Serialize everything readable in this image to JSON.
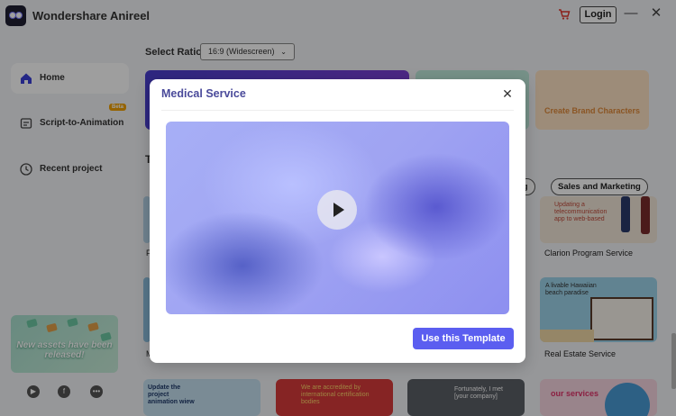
{
  "app": {
    "title": "Wondershare Anireel"
  },
  "header": {
    "login_label": "Login",
    "minimize_symbol": "—",
    "close_symbol": "✕"
  },
  "sidebar": {
    "items": [
      {
        "label": "Home",
        "icon": "home-icon",
        "active": true
      },
      {
        "label": "Script-to-Animation",
        "icon": "script-icon",
        "badge": "Beta"
      },
      {
        "label": "Recent project",
        "icon": "clock-icon"
      }
    ],
    "promo": {
      "text": "New assets have been released!"
    },
    "social": [
      "youtube-icon",
      "facebook-icon",
      "discord-icon"
    ]
  },
  "main": {
    "ratio_label": "Select Ratio",
    "ratio_value": "16:9 (Widescreen)",
    "feature_cards": {
      "brand_characters": "Create Brand Characters"
    },
    "section_letter": "T",
    "chips": [
      "ng",
      "Sales and Marketing"
    ],
    "templates": [
      {
        "name": "Clarion Program Service",
        "thumb_text": "Updating a telecommunication app to web-based"
      },
      {
        "name": "Real Estate Service",
        "thumb_text": "A livable Hawaiian beach paradise"
      }
    ],
    "bottom_thumbs": [
      "Update the project animation wiew",
      "We are accredited by international certification bodies",
      "Fortunately, I met [your company]",
      "our services"
    ],
    "partial_letters": [
      "F",
      "M"
    ]
  },
  "modal": {
    "title": "Medical Service",
    "close_symbol": "✕",
    "cta_label": "Use this Template"
  },
  "colors": {
    "accent": "#5b5ef0",
    "modal_title": "#4a4a9a",
    "promo": "#a9e0cf"
  }
}
